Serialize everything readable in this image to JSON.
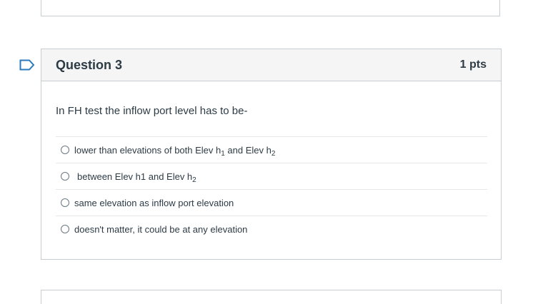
{
  "question": {
    "title": "Question 3",
    "points": "1 pts",
    "text": "In FH test the inflow port level has to be-"
  },
  "answers": [
    {
      "pre": "lower than elevations of both Elev h",
      "sub1": "1",
      "mid": " and Elev h",
      "sub2": "2"
    },
    {
      "pre": "between Elev h1 and Elev h",
      "sub1": "2"
    },
    {
      "text": "same elevation as inflow port elevation"
    },
    {
      "text": "doesn't matter, it could be at any elevation"
    }
  ],
  "icons": {
    "flag": "flag-outline-icon"
  },
  "colors": {
    "flag": "#2b7abc",
    "border": "#c7cdd1",
    "header_bg": "#f5f5f5",
    "text": "#2d3b45"
  }
}
